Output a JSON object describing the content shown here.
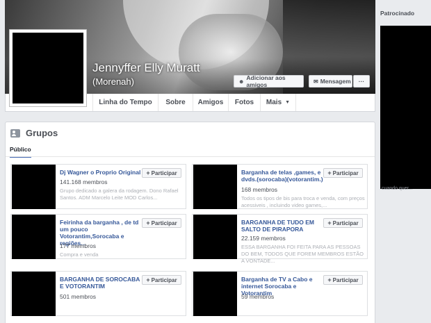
{
  "profile": {
    "name": "Jennyffer Elly Muratt",
    "alternate_name": "(Morenah)",
    "add_friend_label": "Adicionar aos amigos",
    "message_label": "Mensagem",
    "more_label": "···"
  },
  "nav": {
    "items": [
      "Linha do Tempo",
      "Sobre",
      "Amigos",
      "Fotos",
      "Mais"
    ]
  },
  "groups_section": {
    "title": "Grupos",
    "tab": "Público",
    "join_label": "Participar",
    "groups": [
      {
        "name": "Dj Wagner o Proprio Original",
        "members": "141.168 membros",
        "description": "Grupo dedicado a galera da rodagem. Dono Rafael Santos. ADM Marcelo Leite MOD Carlos..."
      },
      {
        "name": "Barganha de telas ,games, e dvds.(sorocaba)(votorantim.)",
        "members": "168 membros",
        "description": "Todos os tipos de bis para troca e venda, com preços acessiveis , incluindo video games,..."
      },
      {
        "name": "Feirinha da barganha , de td um pouco Votorantim,Sorocaba e regiões...",
        "members": "177 membros",
        "description": "Compra e venda"
      },
      {
        "name": "BARGANHA DE TUDO EM SALTO DE PIRAPORA",
        "members": "22.159 membros",
        "description": "ESSA BARGANHA FOI FEITA PARA AS PESSOAS DO BEM, TODOS QUE FOREM MEMBROS ESTÃO A VONTADE..."
      },
      {
        "name": "BARGANHA DE SOROCABA E VOTORANTIM",
        "members": "501 membros",
        "description": ""
      },
      {
        "name": "Barganha de TV a Cabo e internet Sorocaba e Votorantim",
        "members": "59 membros",
        "description": ""
      }
    ]
  },
  "sidebar": {
    "sponsored_label": "Patrocinado",
    "ad_caption": "cuando quer..."
  }
}
